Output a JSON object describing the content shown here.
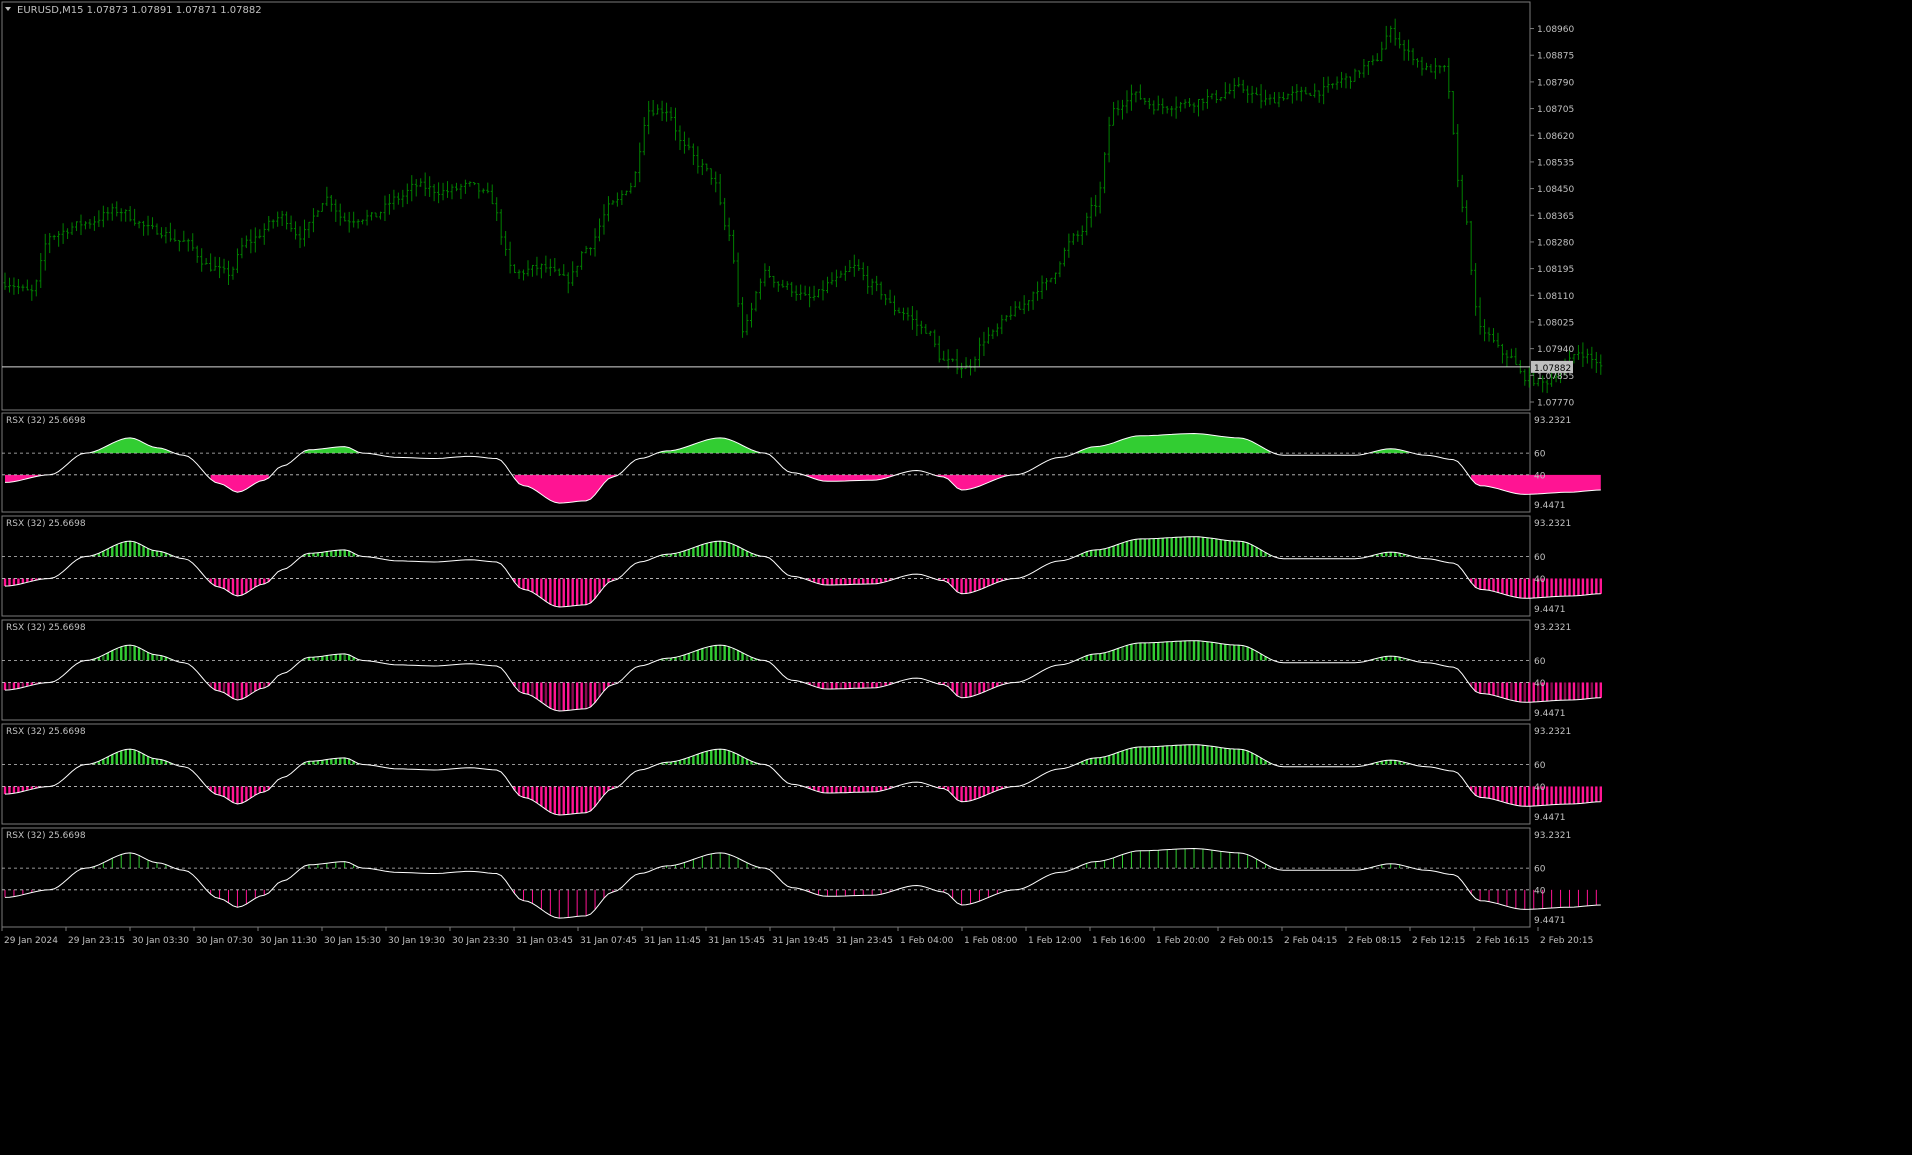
{
  "symbol_label": "EURUSD,M15  1.07873 1.07891 1.07871 1.07882",
  "colors": {
    "background": "#000000",
    "frame": "#7a7a7a",
    "candle": "#008000",
    "price_line": "#d8d8d8",
    "price_tag_bg": "#c0c0c0",
    "axis_text": "#c0c0c0",
    "rsx_line": "#ffffff",
    "rsx_up": "#32cd32",
    "rsx_down": "#ff1493",
    "level_line": "#c8c8c8"
  },
  "price_axis": {
    "ticks": [
      "1.08960",
      "1.08875",
      "1.08790",
      "1.08705",
      "1.08620",
      "1.08535",
      "1.08450",
      "1.08365",
      "1.08280",
      "1.08195",
      "1.08110",
      "1.08025",
      "1.07940",
      "1.07855",
      "1.07770"
    ],
    "current": "1.07882"
  },
  "time_axis": {
    "labels": [
      "29 Jan 2024",
      "29 Jan 23:15",
      "30 Jan 03:30",
      "30 Jan 07:30",
      "30 Jan 11:30",
      "30 Jan 15:30",
      "30 Jan 19:30",
      "30 Jan 23:30",
      "31 Jan 03:45",
      "31 Jan 07:45",
      "31 Jan 11:45",
      "31 Jan 15:45",
      "31 Jan 19:45",
      "31 Jan 23:45",
      "1 Feb 04:00",
      "1 Feb 08:00",
      "1 Feb 12:00",
      "1 Feb 16:00",
      "1 Feb 20:00",
      "2 Feb 00:15",
      "2 Feb 04:15",
      "2 Feb 08:15",
      "2 Feb 12:15",
      "2 Feb 16:15",
      "2 Feb 20:15"
    ]
  },
  "rsx_panels": [
    {
      "label": "RSX (32) 25.6698",
      "max_label": "93.2321",
      "min_label": "9.4471",
      "level_high": "60",
      "level_low": "40",
      "style": "solid"
    },
    {
      "label": "RSX (32) 25.6698",
      "max_label": "93.2321",
      "min_label": "9.4471",
      "level_high": "60",
      "level_low": "40",
      "style": "hist"
    },
    {
      "label": "RSX (32) 25.6698",
      "max_label": "93.2321",
      "min_label": "9.4471",
      "level_high": "60",
      "level_low": "40",
      "style": "dense"
    },
    {
      "label": "RSX (32) 25.6698",
      "max_label": "93.2321",
      "min_label": "9.4471",
      "level_high": "60",
      "level_low": "40",
      "style": "hist"
    },
    {
      "label": "RSX (32) 25.6698",
      "max_label": "93.2321",
      "min_label": "9.4471",
      "level_high": "60",
      "level_low": "40",
      "style": "sparse"
    }
  ],
  "chart_data": [
    {
      "type": "candlestick",
      "title": "EURUSD,M15",
      "series_name": "EURUSD",
      "ylim": [
        1.0777,
        1.09
      ],
      "close_key_points": [
        [
          0,
          1.0815
        ],
        [
          6,
          1.0812
        ],
        [
          10,
          1.083
        ],
        [
          18,
          1.0834
        ],
        [
          25,
          1.0838
        ],
        [
          33,
          1.0832
        ],
        [
          40,
          1.0828
        ],
        [
          46,
          1.082
        ],
        [
          50,
          1.0818
        ],
        [
          54,
          1.0828
        ],
        [
          62,
          1.0836
        ],
        [
          66,
          1.083
        ],
        [
          72,
          1.0842
        ],
        [
          76,
          1.0835
        ],
        [
          82,
          1.0836
        ],
        [
          88,
          1.0842
        ],
        [
          92,
          1.0846
        ],
        [
          98,
          1.0844
        ],
        [
          104,
          1.0846
        ],
        [
          108,
          1.0843
        ],
        [
          114,
          1.0818
        ],
        [
          120,
          1.082
        ],
        [
          126,
          1.0816
        ],
        [
          130,
          1.0826
        ],
        [
          136,
          1.084
        ],
        [
          140,
          1.0846
        ],
        [
          144,
          1.087
        ],
        [
          148,
          1.087
        ],
        [
          152,
          1.0858
        ],
        [
          156,
          1.0852
        ],
        [
          158,
          1.0849
        ],
        [
          162,
          1.083
        ],
        [
          165,
          1.08
        ],
        [
          170,
          1.0818
        ],
        [
          174,
          1.0814
        ],
        [
          180,
          1.081
        ],
        [
          186,
          1.0816
        ],
        [
          190,
          1.082
        ],
        [
          194,
          1.0814
        ],
        [
          200,
          1.0806
        ],
        [
          206,
          1.08
        ],
        [
          210,
          1.079
        ],
        [
          215,
          1.0788
        ],
        [
          220,
          1.0798
        ],
        [
          226,
          1.0806
        ],
        [
          232,
          1.0814
        ],
        [
          240,
          1.083
        ],
        [
          244,
          1.084
        ],
        [
          248,
          1.087
        ],
        [
          252,
          1.0875
        ],
        [
          258,
          1.0871
        ],
        [
          264,
          1.0872
        ],
        [
          270,
          1.0874
        ],
        [
          276,
          1.0877
        ],
        [
          282,
          1.0873
        ],
        [
          288,
          1.0875
        ],
        [
          294,
          1.0876
        ],
        [
          300,
          1.088
        ],
        [
          306,
          1.0885
        ],
        [
          310,
          1.0895
        ],
        [
          314,
          1.0888
        ],
        [
          318,
          1.0883
        ],
        [
          322,
          1.0883
        ],
        [
          326,
          1.084
        ],
        [
          330,
          1.08
        ],
        [
          336,
          1.0792
        ],
        [
          340,
          1.0785
        ],
        [
          344,
          1.0783
        ],
        [
          348,
          1.0787
        ],
        [
          352,
          1.0793
        ],
        [
          356,
          1.079
        ],
        [
          357,
          1.0788
        ]
      ],
      "last": {
        "open": 1.07873,
        "high": 1.07891,
        "low": 1.07871,
        "close": 1.07882
      }
    },
    {
      "type": "line",
      "title": "RSX (32)",
      "current_value": 25.6698,
      "ylim": [
        9.4471,
        93.2321
      ],
      "levels": [
        60,
        40
      ],
      "key_points": [
        [
          0,
          33
        ],
        [
          10,
          40
        ],
        [
          18,
          60
        ],
        [
          28,
          74
        ],
        [
          34,
          65
        ],
        [
          40,
          58
        ],
        [
          48,
          32
        ],
        [
          52,
          24
        ],
        [
          58,
          35
        ],
        [
          62,
          48
        ],
        [
          68,
          63
        ],
        [
          76,
          66
        ],
        [
          80,
          60
        ],
        [
          88,
          56
        ],
        [
          96,
          55
        ],
        [
          104,
          57
        ],
        [
          110,
          55
        ],
        [
          116,
          30
        ],
        [
          124,
          14
        ],
        [
          130,
          16
        ],
        [
          136,
          38
        ],
        [
          142,
          55
        ],
        [
          148,
          62
        ],
        [
          160,
          74
        ],
        [
          170,
          60
        ],
        [
          176,
          42
        ],
        [
          184,
          34
        ],
        [
          194,
          35
        ],
        [
          204,
          44
        ],
        [
          210,
          38
        ],
        [
          214,
          26
        ],
        [
          226,
          40
        ],
        [
          236,
          56
        ],
        [
          244,
          66
        ],
        [
          254,
          76
        ],
        [
          266,
          78
        ],
        [
          276,
          74
        ],
        [
          286,
          58
        ],
        [
          296,
          58
        ],
        [
          302,
          58
        ],
        [
          310,
          64
        ],
        [
          318,
          58
        ],
        [
          324,
          54
        ],
        [
          330,
          30
        ],
        [
          340,
          22
        ],
        [
          350,
          24
        ],
        [
          357,
          26
        ]
      ]
    }
  ]
}
